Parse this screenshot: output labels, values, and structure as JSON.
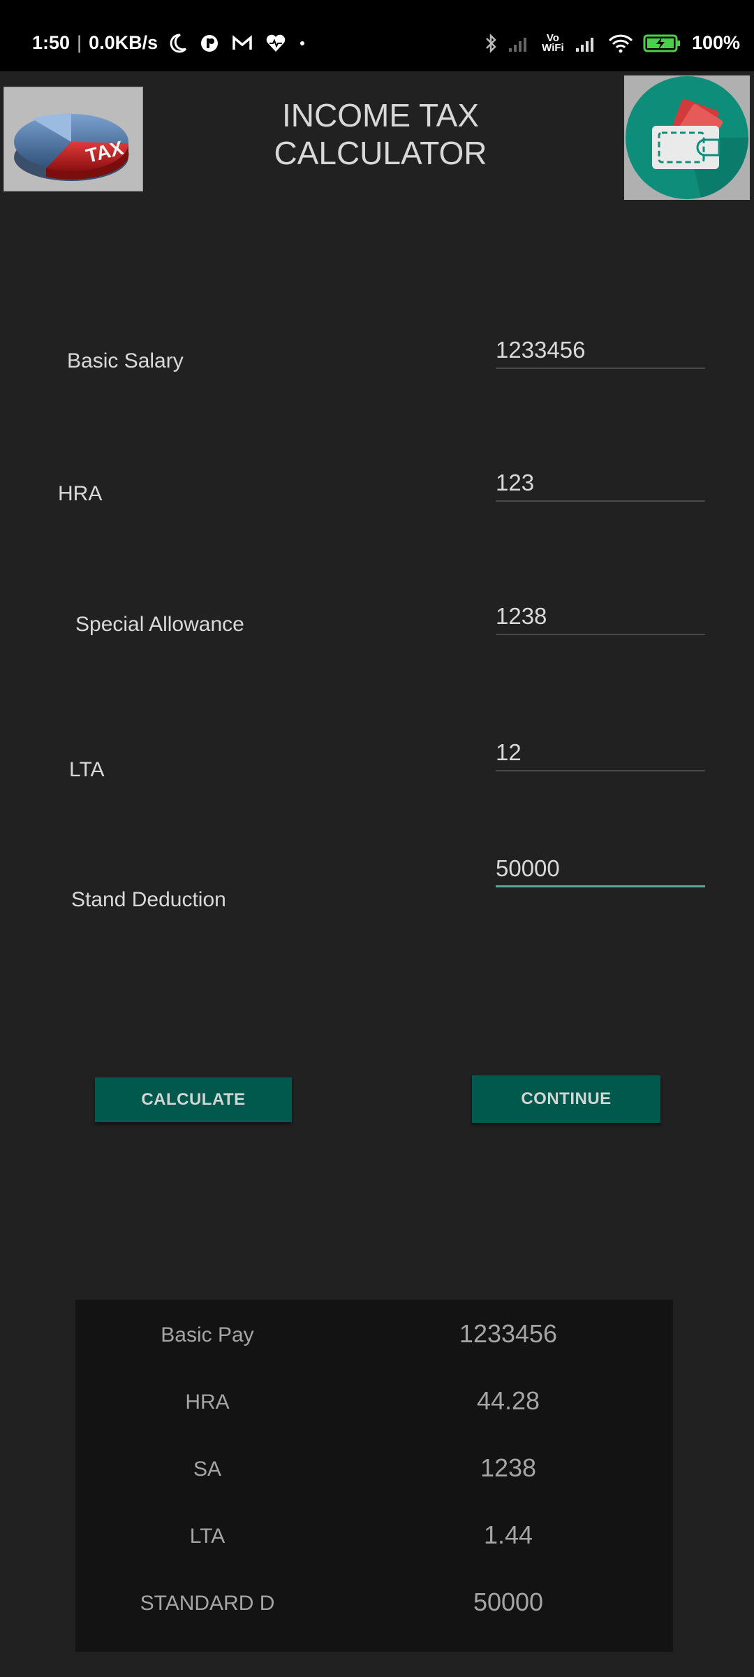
{
  "status_bar": {
    "time": "1:50",
    "net_speed": "0.0KB/s",
    "vo_wifi": "Vo WiFi",
    "battery": "100%"
  },
  "app": {
    "title": "INCOME TAX\nCALCULATOR",
    "left_logo_text": "TAX"
  },
  "form": {
    "basic_salary": {
      "label": "Basic Salary",
      "value": "1233456"
    },
    "hra": {
      "label": "HRA",
      "value": "123"
    },
    "special_allowance": {
      "label": "Special Allowance",
      "value": "1238"
    },
    "lta": {
      "label": "LTA",
      "value": "12"
    },
    "stand_deduction": {
      "label": "Stand Deduction",
      "value": "50000"
    }
  },
  "buttons": {
    "calculate": "CALCULATE",
    "continue": "CONTINUE"
  },
  "results": [
    {
      "label": "Basic Pay",
      "value": "1233456"
    },
    {
      "label": "HRA",
      "value": "44.28"
    },
    {
      "label": "SA",
      "value": "1238"
    },
    {
      "label": "LTA",
      "value": "1.44"
    },
    {
      "label": "STANDARD D",
      "value": "50000"
    }
  ],
  "colors": {
    "background": "#212121",
    "accent": "#00594c",
    "focus_underline": "#5aa89a"
  }
}
